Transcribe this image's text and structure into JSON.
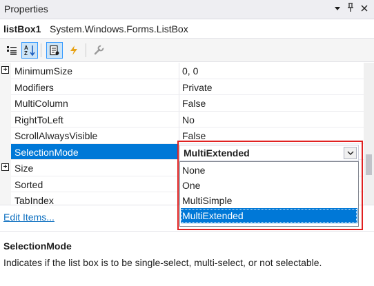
{
  "window": {
    "title": "Properties",
    "controls": [
      "dropdown-arrow",
      "pin",
      "close"
    ]
  },
  "object": {
    "name": "listBox1",
    "type": "System.Windows.Forms.ListBox"
  },
  "toolbar": {
    "buttons": [
      {
        "icon": "categorized-icon",
        "pressed": false
      },
      {
        "icon": "alphabetical-icon",
        "pressed": true
      },
      {
        "icon": "properties-icon",
        "pressed": true
      },
      {
        "icon": "events-icon",
        "pressed": false
      },
      {
        "icon": "property-pages-icon",
        "pressed": false
      }
    ]
  },
  "properties": [
    {
      "name": "MinimumSize",
      "value": "0, 0",
      "expandable": true
    },
    {
      "name": "Modifiers",
      "value": "Private",
      "expandable": false
    },
    {
      "name": "MultiColumn",
      "value": "False",
      "expandable": false
    },
    {
      "name": "RightToLeft",
      "value": "No",
      "expandable": false
    },
    {
      "name": "ScrollAlwaysVisible",
      "value": "False",
      "expandable": false
    },
    {
      "name": "SelectionMode",
      "value": "MultiExtended",
      "expandable": false,
      "selected": true
    },
    {
      "name": "Size",
      "value": "",
      "expandable": true
    },
    {
      "name": "Sorted",
      "value": "",
      "expandable": false
    },
    {
      "name": "TabIndex",
      "value": "",
      "expandable": false
    }
  ],
  "dropdown": {
    "current": "MultiExtended",
    "options": [
      "None",
      "One",
      "MultiSimple",
      "MultiExtended"
    ],
    "selected_index": 3
  },
  "commands": {
    "edit_items": "Edit Items..."
  },
  "description": {
    "title": "SelectionMode",
    "text": "Indicates if the list box is to be single-select, multi-select, or not selectable."
  },
  "colors": {
    "selection": "#0078d7",
    "highlight_box": "#e02020",
    "link": "#0e70c0",
    "events_icon": "#e8a317"
  }
}
